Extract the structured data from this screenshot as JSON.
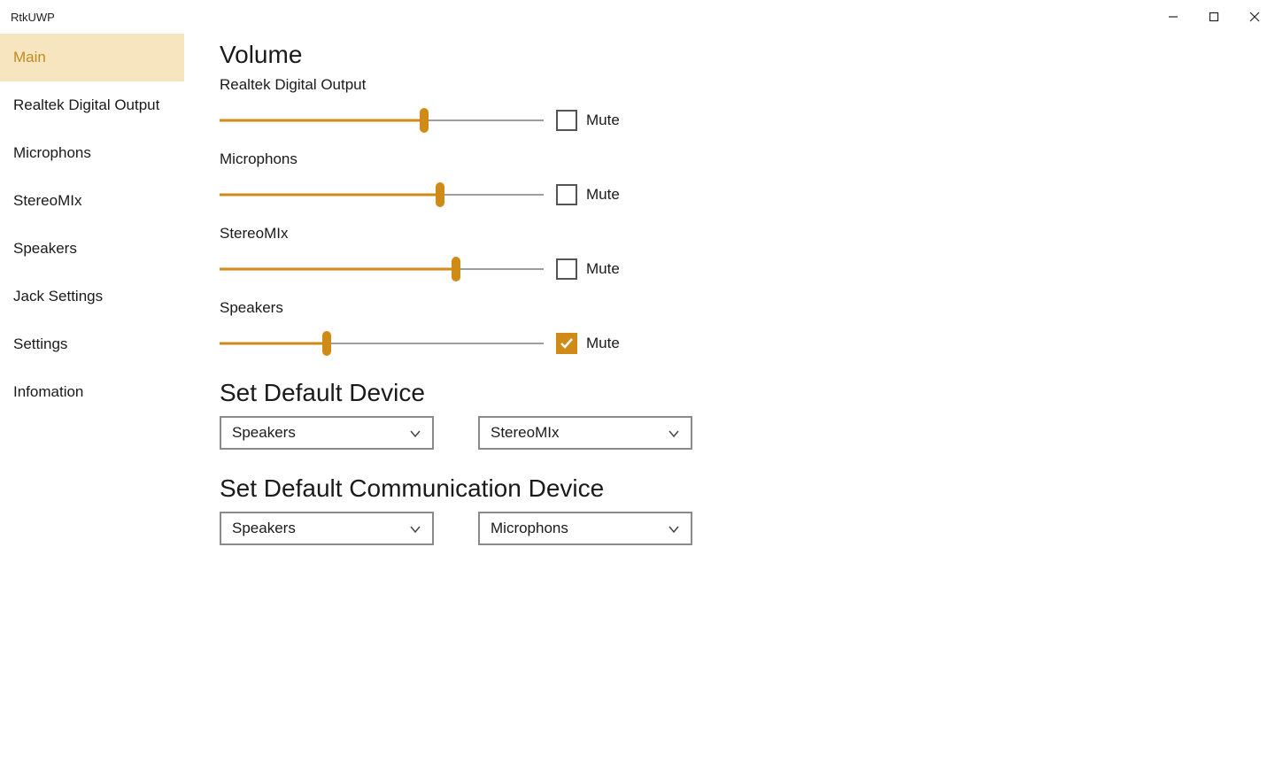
{
  "window": {
    "title": "RtkUWP"
  },
  "colors": {
    "accent": "#d08b17",
    "sidebar_active_bg": "#f7e5bf"
  },
  "sidebar": {
    "items": [
      {
        "label": "Main",
        "active": true
      },
      {
        "label": "Realtek Digital Output",
        "active": false
      },
      {
        "label": "Microphons",
        "active": false
      },
      {
        "label": "StereoMIx",
        "active": false
      },
      {
        "label": "Speakers",
        "active": false
      },
      {
        "label": "Jack Settings",
        "active": false
      },
      {
        "label": "Settings",
        "active": false
      },
      {
        "label": "Infomation",
        "active": false
      }
    ]
  },
  "main": {
    "sections": {
      "volume_title": "Volume",
      "default_device_title": "Set Default Device",
      "default_comm_device_title": "Set Default Communication Device"
    },
    "mute_label": "Mute",
    "devices": [
      {
        "name": "Realtek Digital Output",
        "level": 63,
        "muted": false
      },
      {
        "name": "Microphons",
        "level": 68,
        "muted": false
      },
      {
        "name": "StereoMIx",
        "level": 73,
        "muted": false
      },
      {
        "name": "Speakers",
        "level": 33,
        "muted": true
      }
    ],
    "default_device": {
      "output": "Speakers",
      "input": "StereoMIx"
    },
    "default_comm_device": {
      "output": "Speakers",
      "input": "Microphons"
    }
  }
}
